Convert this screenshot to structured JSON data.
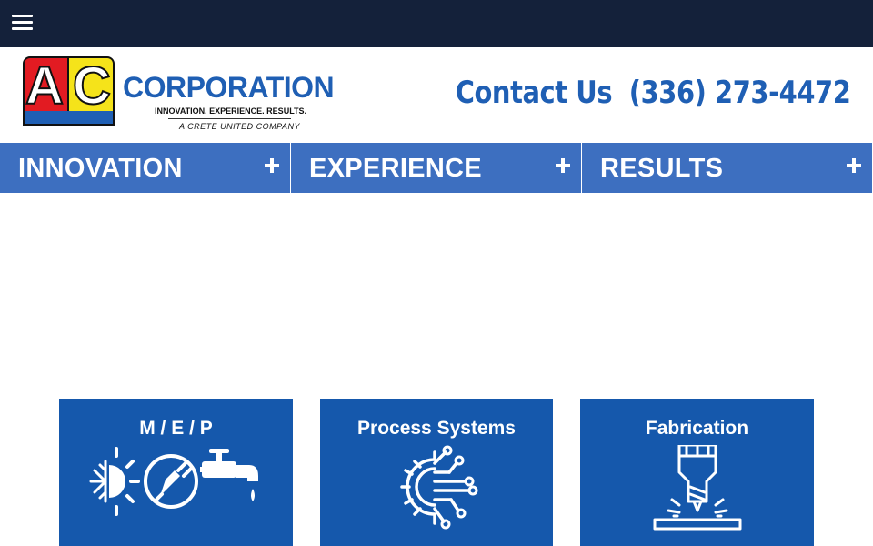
{
  "topbar": {
    "menu_icon": "hamburger-menu-icon"
  },
  "header": {
    "logo": {
      "letter_a": "A",
      "letter_c": "C",
      "name": "CORPORATION",
      "tagline": "INNOVATION. EXPERIENCE. RESULTS.",
      "subline": "A CRETE UNITED COMPANY"
    },
    "contact_label": "Contact Us",
    "phone": "(336) 273-4472"
  },
  "nav": {
    "items": [
      {
        "label": "INNOVATION",
        "icon": "plus-icon"
      },
      {
        "label": "EXPERIENCE",
        "icon": "plus-icon"
      },
      {
        "label": "RESULTS",
        "icon": "plus-icon"
      }
    ]
  },
  "cards": [
    {
      "title": "M / E / P",
      "icon": "mep-icons"
    },
    {
      "title": "Process Systems",
      "icon": "gear-circuit-icon"
    },
    {
      "title": "Fabrication",
      "icon": "drill-press-icon"
    }
  ],
  "colors": {
    "topbar": "#14213a",
    "nav": "#3d6fc0",
    "brand_blue": "#1f5fb4",
    "card": "#1558ac",
    "logo_red": "#e21b22",
    "logo_yellow": "#f5e31a"
  }
}
